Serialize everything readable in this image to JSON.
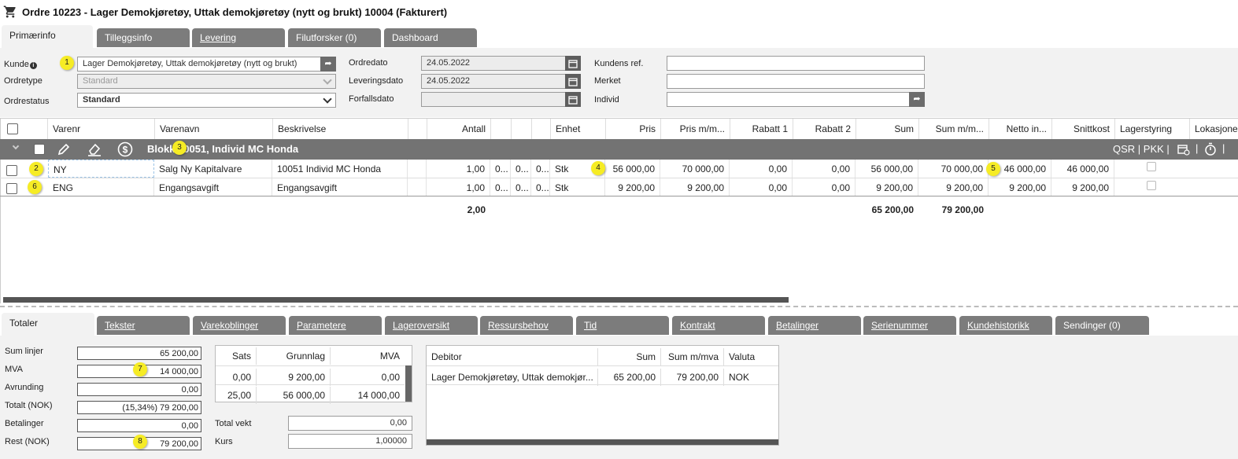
{
  "title": "Ordre 10223 - Lager Demokjøretøy, Uttak demokjøretøy (nytt og brukt) 10004 (Fakturert)",
  "top_tabs": [
    {
      "label": "Primærinfo"
    },
    {
      "label": "Tilleggsinfo"
    },
    {
      "label": "Levering"
    },
    {
      "label": "Filutforsker (0)"
    },
    {
      "label": "Dashboard"
    }
  ],
  "form": {
    "kunde_label": "Kunde",
    "kunde_value": "Lager Demokjøretøy, Uttak demokjøretøy (nytt og brukt)",
    "ordretype_label": "Ordretype",
    "ordretype_value": "Standard",
    "ordrestatus_label": "Ordrestatus",
    "ordrestatus_value": "Standard",
    "ordredato_label": "Ordredato",
    "ordredato_value": "24.05.2022",
    "leveringsdato_label": "Leveringsdato",
    "leveringsdato_value": "24.05.2022",
    "forfallsdato_label": "Forfallsdato",
    "forfallsdato_value": "",
    "kundens_ref_label": "Kundens ref.",
    "merket_label": "Merket",
    "individ_label": "Individ"
  },
  "badges": [
    "1",
    "2",
    "3",
    "4",
    "5",
    "6",
    "7",
    "8"
  ],
  "grid": {
    "headers": [
      "Varenr",
      "Varenavn",
      "Beskrivelse",
      "Antall",
      "Enhet",
      "Pris",
      "Pris m/m...",
      "Rabatt 1",
      "Rabatt 2",
      "Sum",
      "Sum m/m...",
      "Netto in...",
      "Snittkost",
      "Lagerstyring",
      "Lokasjone"
    ],
    "group_title": "Blokk 10051, Individ MC Honda",
    "group_actions": "QSR | PKK |",
    "rows": [
      {
        "varenr": "NY",
        "varenavn": "Salg Ny Kapitalvare",
        "beskrivelse": "10051 Individ MC Honda",
        "antall": "1,00",
        "c1": "0...",
        "c2": "0...",
        "c3": "0...",
        "enhet": "Stk",
        "pris": "56 000,00",
        "pris_mm": "70 000,00",
        "rabatt1": "0,00",
        "rabatt2": "0,00",
        "sum": "56 000,00",
        "sum_mm": "70 000,00",
        "netto": "46 000,00",
        "snittkost": "46 000,00"
      },
      {
        "varenr": "ENG",
        "varenavn": "Engangsavgift",
        "beskrivelse": "Engangsavgift",
        "antall": "1,00",
        "c1": "0...",
        "c2": "0...",
        "c3": "0...",
        "enhet": "Stk",
        "pris": "9 200,00",
        "pris_mm": "9 200,00",
        "rabatt1": "0,00",
        "rabatt2": "0,00",
        "sum": "9 200,00",
        "sum_mm": "9 200,00",
        "netto": "9 200,00",
        "snittkost": "9 200,00"
      }
    ],
    "totals": {
      "antall": "2,00",
      "sum": "65 200,00",
      "sum_mm": "79 200,00"
    }
  },
  "bottom_tabs": [
    {
      "label": "Totaler"
    },
    {
      "label": "Tekster"
    },
    {
      "label": "Varekoblinger"
    },
    {
      "label": "Parametere"
    },
    {
      "label": "Lageroversikt"
    },
    {
      "label": "Ressursbehov"
    },
    {
      "label": "Tid"
    },
    {
      "label": "Kontrakt"
    },
    {
      "label": "Betalinger"
    },
    {
      "label": "Serienummer"
    },
    {
      "label": "Kundehistorikk"
    },
    {
      "label": "Sendinger (0)"
    }
  ],
  "totals": {
    "items": [
      {
        "label": "Sum linjer",
        "value": "65 200,00"
      },
      {
        "label": "MVA",
        "value": "14 000,00"
      },
      {
        "label": "Avrunding",
        "value": "0,00"
      },
      {
        "label": "Totalt (NOK)",
        "value": "(15,34%) 79 200,00"
      },
      {
        "label": "Betalinger",
        "value": "0,00"
      },
      {
        "label": "Rest (NOK)",
        "value": "79 200,00"
      }
    ]
  },
  "vat_table": {
    "headers": [
      "Sats",
      "Grunnlag",
      "MVA"
    ],
    "rows": [
      [
        "0,00",
        "9 200,00",
        "0,00"
      ],
      [
        "25,00",
        "56 000,00",
        "14 000,00"
      ]
    ]
  },
  "weight": {
    "label": "Total vekt",
    "value": "0,00"
  },
  "kurs": {
    "label": "Kurs",
    "value": "1,00000"
  },
  "debitor_table": {
    "headers": [
      "Debitor",
      "Sum",
      "Sum m/mva",
      "Valuta"
    ],
    "rows": [
      [
        "Lager Demokjøretøy, Uttak demokjør...",
        "65 200,00",
        "79 200,00",
        "NOK"
      ]
    ]
  },
  "colors": {
    "tab_grey": "#7c7c7c",
    "badge_yellow": "#f6ec25",
    "group_row": "#737373"
  }
}
